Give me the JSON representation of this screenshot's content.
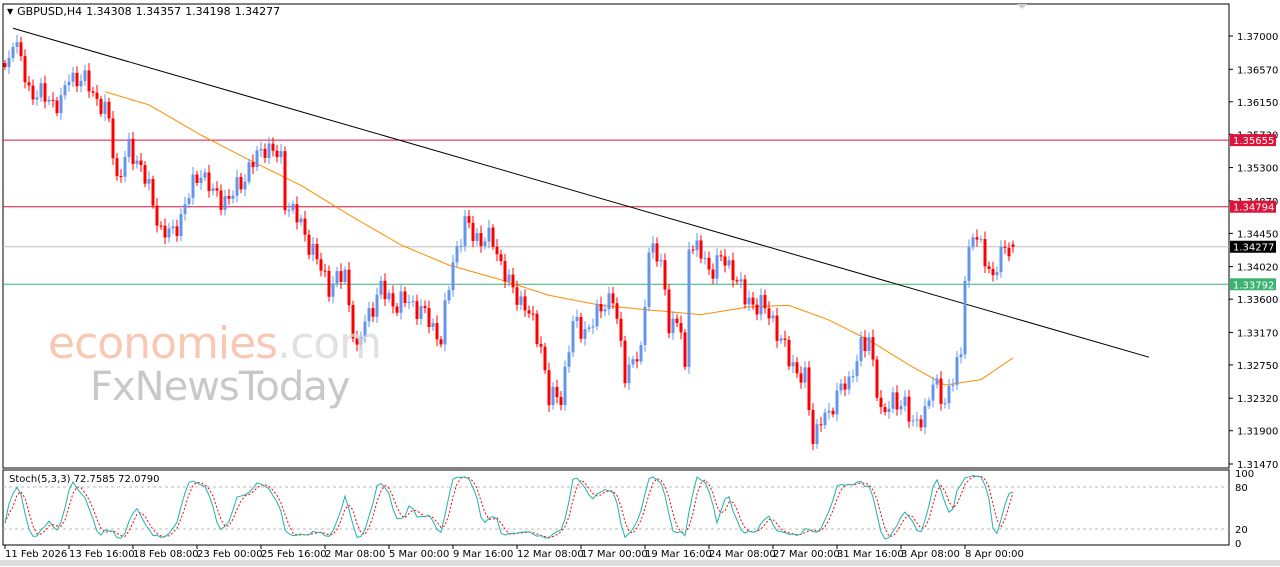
{
  "header": {
    "symbol": "GBPUSD,H4",
    "open": "1.34308",
    "high": "1.34357",
    "low": "1.34198",
    "close": "1.34277"
  },
  "watermark": {
    "brand1": "economies",
    "brand1_suffix": ".com",
    "brand2": "FxNewsToday"
  },
  "price_axis": {
    "ticks": [
      "1.37000",
      "1.36570",
      "1.36150",
      "1.35730",
      "1.35300",
      "1.34870",
      "1.34450",
      "1.34020",
      "1.33600",
      "1.33170",
      "1.32750",
      "1.32320",
      "1.31900",
      "1.31470"
    ],
    "min": 1.3147,
    "max": 1.37
  },
  "levels": [
    {
      "price": 1.35655,
      "label": "1.35655",
      "color": "#dc143c"
    },
    {
      "price": 1.34794,
      "label": "1.34794",
      "color": "#dc143c"
    },
    {
      "price": 1.34277,
      "label": "1.34277",
      "color": "#000000",
      "line": "#c0c0c0"
    },
    {
      "price": 1.33792,
      "label": "1.33792",
      "color": "#3cb371"
    }
  ],
  "time_axis": [
    "11 Feb 2026",
    "13 Feb 16:00",
    "18 Feb 08:00",
    "23 Feb 00:00",
    "25 Feb 16:00",
    "2 Mar 08:00",
    "5 Mar 00:00",
    "9 Mar 16:00",
    "12 Mar 08:00",
    "17 Mar 00:00",
    "19 Mar 16:00",
    "24 Mar 08:00",
    "27 Mar 00:00",
    "31 Mar 16:00",
    "3 Apr 08:00",
    "8 Apr 00:00"
  ],
  "stochastic": {
    "label": "Stoch(5,3,3) 72.7585 72.0790",
    "levels": [
      "100",
      "80",
      "20",
      "0"
    ]
  },
  "colors": {
    "bull": "#6495ed",
    "bear": "#ff0000",
    "ma": "#ff8c00",
    "trend": "#000000",
    "stoch_main": "#20b2aa",
    "stoch_signal": "#ff0000"
  },
  "chart_data": {
    "type": "candlestick",
    "timeframe": "H4",
    "bars_per_time_label": 16,
    "last_bar": {
      "open": 1.34308,
      "high": 1.34357,
      "low": 1.34198,
      "close": 1.34277
    },
    "close_anchors": [
      [
        0,
        1.366
      ],
      [
        1,
        1.3669
      ],
      [
        2,
        1.3701
      ],
      [
        6,
        1.363
      ],
      [
        14,
        1.3611
      ],
      [
        16,
        1.365
      ],
      [
        21,
        1.3637
      ],
      [
        26,
        1.3591
      ],
      [
        28,
        1.3514
      ],
      [
        31,
        1.3553
      ],
      [
        34,
        1.3533
      ],
      [
        39,
        1.3449
      ],
      [
        42,
        1.3443
      ],
      [
        46,
        1.3495
      ],
      [
        49,
        1.3527
      ],
      [
        52,
        1.3495
      ],
      [
        56,
        1.3488
      ],
      [
        60,
        1.352
      ],
      [
        65,
        1.3559
      ],
      [
        69,
        1.354
      ],
      [
        70,
        1.3488
      ],
      [
        74,
        1.3456
      ],
      [
        79,
        1.3398
      ],
      [
        81,
        1.3378
      ],
      [
        85,
        1.3391
      ],
      [
        88,
        1.3288
      ],
      [
        90,
        1.3333
      ],
      [
        94,
        1.3372
      ],
      [
        98,
        1.3352
      ],
      [
        101,
        1.3359
      ],
      [
        106,
        1.3333
      ],
      [
        109,
        1.3307
      ],
      [
        112,
        1.3411
      ],
      [
        115,
        1.3456
      ],
      [
        119,
        1.3436
      ],
      [
        122,
        1.3436
      ],
      [
        126,
        1.3378
      ],
      [
        130,
        1.3352
      ],
      [
        134,
        1.3301
      ],
      [
        136,
        1.323
      ],
      [
        139,
        1.3236
      ],
      [
        142,
        1.3327
      ],
      [
        146,
        1.332
      ],
      [
        150,
        1.3359
      ],
      [
        152,
        1.3359
      ],
      [
        155,
        1.3268
      ],
      [
        159,
        1.3288
      ],
      [
        161,
        1.343
      ],
      [
        164,
        1.3404
      ],
      [
        166,
        1.3333
      ],
      [
        169,
        1.332
      ],
      [
        170,
        1.3262
      ],
      [
        171,
        1.3436
      ],
      [
        174,
        1.3417
      ],
      [
        176,
        1.3398
      ],
      [
        179,
        1.3411
      ],
      [
        182,
        1.3398
      ],
      [
        185,
        1.3359
      ],
      [
        189,
        1.3352
      ],
      [
        192,
        1.3333
      ],
      [
        196,
        1.3281
      ],
      [
        200,
        1.3256
      ],
      [
        202,
        1.3178
      ],
      [
        204,
        1.321
      ],
      [
        206,
        1.3204
      ],
      [
        209,
        1.3256
      ],
      [
        211,
        1.3243
      ],
      [
        214,
        1.3307
      ],
      [
        216,
        1.3301
      ],
      [
        219,
        1.3217
      ],
      [
        222,
        1.3223
      ],
      [
        225,
        1.323
      ],
      [
        227,
        1.3191
      ],
      [
        230,
        1.3217
      ],
      [
        232,
        1.3249
      ],
      [
        235,
        1.323
      ],
      [
        237,
        1.3256
      ],
      [
        239,
        1.3288
      ],
      [
        240,
        1.3398
      ],
      [
        242,
        1.3443
      ],
      [
        245,
        1.3417
      ],
      [
        247,
        1.3385
      ],
      [
        250,
        1.343
      ],
      [
        252,
        1.34277
      ]
    ],
    "moving_average": [
      [
        25,
        1.3628
      ],
      [
        36,
        1.3611
      ],
      [
        49,
        1.3572
      ],
      [
        61,
        1.354
      ],
      [
        74,
        1.3507
      ],
      [
        86,
        1.3469
      ],
      [
        99,
        1.343
      ],
      [
        111,
        1.3404
      ],
      [
        124,
        1.3385
      ],
      [
        136,
        1.3365
      ],
      [
        149,
        1.3352
      ],
      [
        161,
        1.3346
      ],
      [
        174,
        1.334
      ],
      [
        186,
        1.335
      ],
      [
        196,
        1.3352
      ],
      [
        206,
        1.3333
      ],
      [
        216,
        1.3307
      ],
      [
        226,
        1.3275
      ],
      [
        235,
        1.3249
      ],
      [
        244,
        1.3256
      ],
      [
        252,
        1.3284
      ]
    ],
    "trendline": [
      [
        2,
        1.371
      ],
      [
        286,
        1.3285
      ]
    ],
    "stoch_last": {
      "main": 72.7585,
      "signal": 72.079
    }
  }
}
